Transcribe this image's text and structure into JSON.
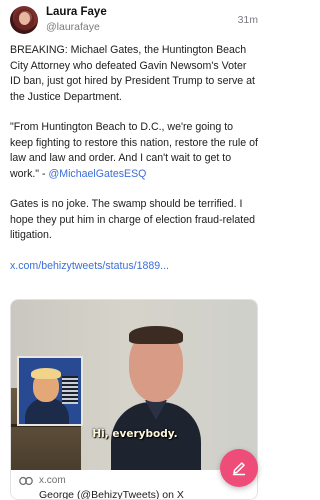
{
  "post": {
    "author_name": "Laura Faye",
    "author_handle": "@laurafaye",
    "time": "31m",
    "paragraphs": [
      "BREAKING: Michael Gates, the Huntington Beach City Attorney who defeated Gavin Newsom's Voter ID ban, just got hired by President Trump to serve at the Justice Department.",
      "\"From Huntington Beach to D.C., we're going to keep fighting to restore this nation, restore the rule of law and law and order. And I can't wait to get to work.\" - ",
      "Gates is no joke. The swamp should be terrified. I hope they put him in charge of election fraud-related litigation."
    ],
    "mention": "@MichaelGatesESQ",
    "link_text": "x.com/behizytweets/status/1889..."
  },
  "card": {
    "video_caption": "Hi, everybody.",
    "domain": "x.com",
    "title": "George (@BehizyTweets) on X"
  },
  "icons": {
    "link": "link-icon",
    "compose": "pencil-icon"
  },
  "colors": {
    "accent_link": "#3b6fd8",
    "fab": "#ef4d79"
  }
}
